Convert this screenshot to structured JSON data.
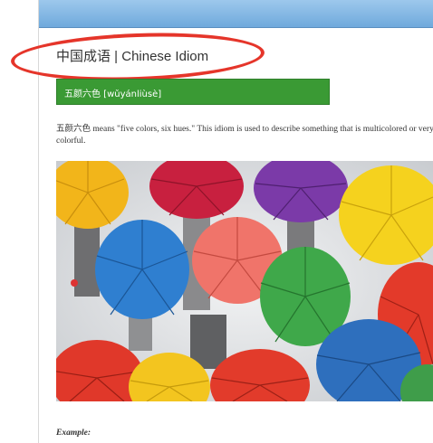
{
  "page": {
    "title": "中国成语 | Chinese Idiom",
    "banner": "五颜六色 [wǔyánliùsè]",
    "description": "五颜六色 means \"five colors, six hues.\" This idiom is used to describe something that is multicolored or very colorful.",
    "example_label": "Example:"
  },
  "colors": {
    "top_bar": "#7fb6e3",
    "banner": "#3a9a34",
    "highlight": "#e5352a"
  },
  "illustration": {
    "subject": "crowd of people holding colorful umbrellas in the rain",
    "umbrella_colors": [
      "#f2b51a",
      "#c8203f",
      "#7b3aa8",
      "#f5d21e",
      "#2f7fd0",
      "#f0746a",
      "#3fa84a",
      "#e33a2a",
      "#2e6fbd",
      "#f3c51f",
      "#e0382a",
      "#3f9d4a"
    ]
  }
}
